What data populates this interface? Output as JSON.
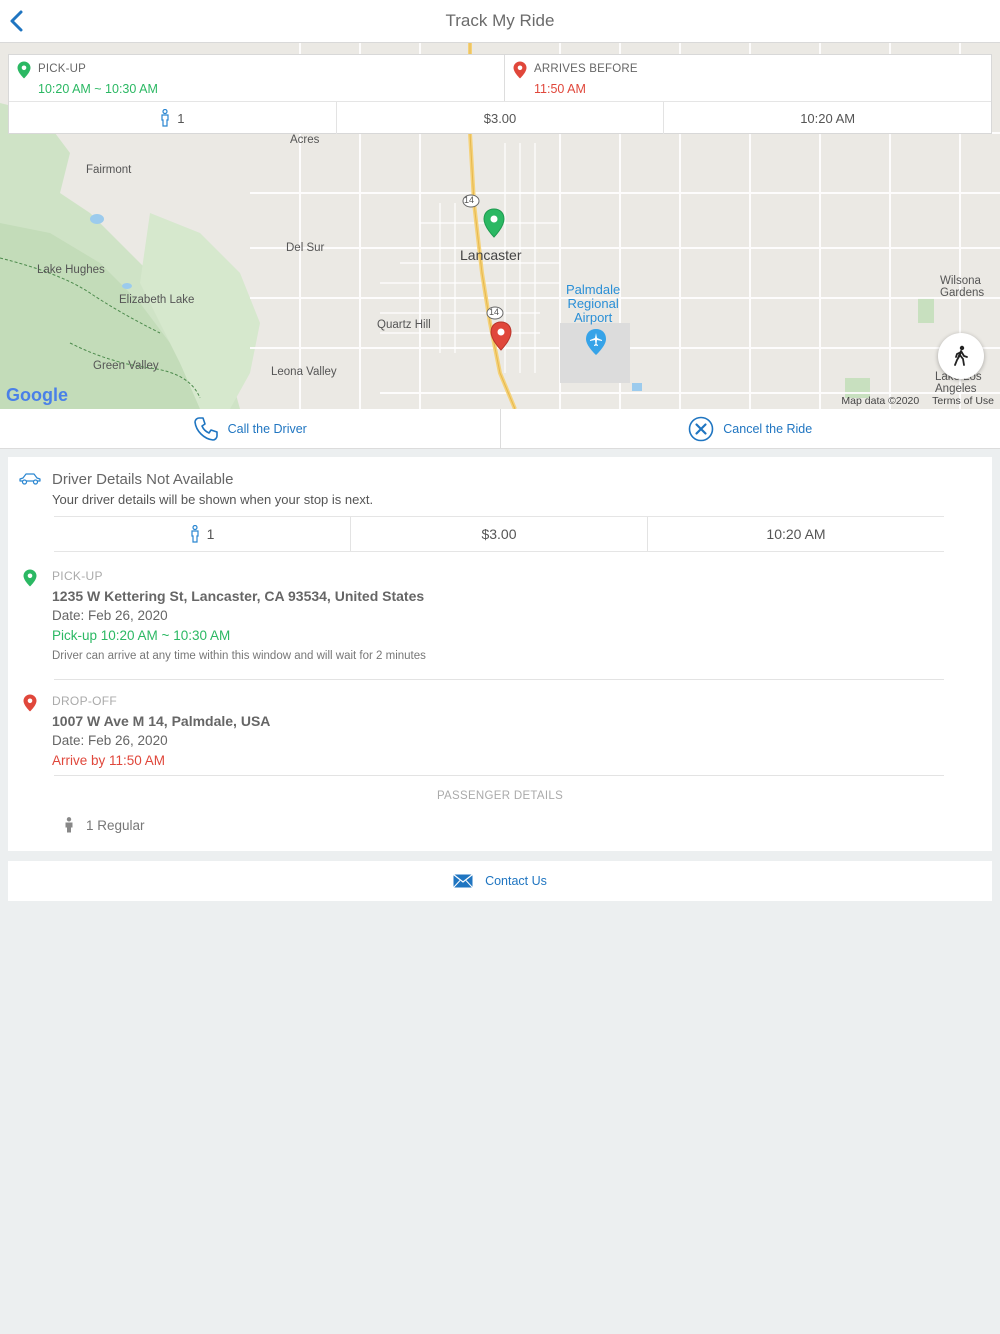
{
  "header": {
    "title": "Track My Ride",
    "back_icon": "chevron-left-icon"
  },
  "trip": {
    "pickup_label": "PICK-UP",
    "pickup_window": "10:20 AM ~ 10:30 AM",
    "arrives_label": "ARRIVES BEFORE",
    "arrives_time": "11:50 AM",
    "passengers": "1",
    "fare": "$3.00",
    "time": "10:20 AM"
  },
  "map": {
    "labels": {
      "antelope_acres": "Antelope\nAcres",
      "fairmont": "Fairmont",
      "del_sur": "Del Sur",
      "lancaster": "Lancaster",
      "lake_hughes": "Lake Hughes",
      "elizabeth_lake": "Elizabeth Lake",
      "quartz_hill": "Quartz Hill",
      "green_valley": "Green Valley",
      "leona_valley": "Leona Valley",
      "airport": "Palmdale\nRegional\nAirport",
      "wilsona": "Wilsona\nGardens",
      "lake_los_angeles": "Lake Los\nAngeles",
      "route_shield": "14"
    },
    "google_logo": "Google",
    "map_data": "Map data ©2020",
    "terms": "Terms of Use"
  },
  "actions": {
    "call": "Call the Driver",
    "cancel": "Cancel the Ride"
  },
  "driver": {
    "title": "Driver Details Not Available",
    "subtitle": "Your driver details will be shown when your stop is next.",
    "passengers": "1",
    "fare": "$3.00",
    "time": "10:20 AM"
  },
  "pickup": {
    "label": "PICK-UP",
    "address": "1235 W Kettering St, Lancaster, CA 93534, United States",
    "date": "Date: Feb 26, 2020",
    "time": "Pick-up 10:20 AM ~ 10:30 AM",
    "note": "Driver can arrive at any time within this window and will wait for 2 minutes"
  },
  "dropoff": {
    "label": "DROP-OFF",
    "address": "1007 W Ave M 14, Palmdale, USA",
    "date": "Date: Feb 26, 2020",
    "time": "Arrive by 11:50 AM"
  },
  "passenger_details": {
    "title": "PASSENGER DETAILS",
    "item": "1 Regular"
  },
  "contact": {
    "label": "Contact Us"
  },
  "colors": {
    "accent": "#1f75c1",
    "green": "#2bb863",
    "red": "#e0473b"
  }
}
